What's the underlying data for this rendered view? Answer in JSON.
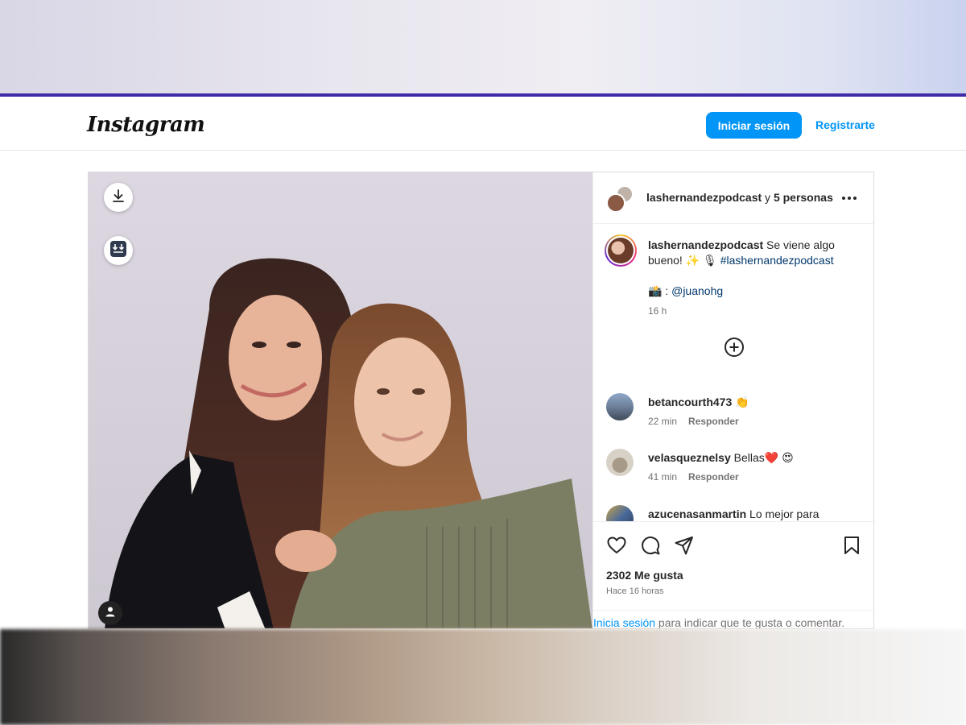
{
  "header": {
    "logo": "Instagram",
    "login_label": "Iniciar sesión",
    "register_label": "Registrarte"
  },
  "post": {
    "owner": "lashernandezpodcast",
    "collab_joiner": " y ",
    "collab_others": "5 personas",
    "caption_user": "lashernandezpodcast",
    "caption_text": " Se viene algo bueno! ✨ 🎙 ",
    "caption_hashtag": "#lashernandezpodcast",
    "credit_prefix": "📸 : ",
    "credit_user": "@juanohg",
    "caption_time": "16 h",
    "comments": [
      {
        "user": "betancourth473",
        "text": " 👏",
        "time": "22 min",
        "reply": "Responder"
      },
      {
        "user": "velasqueznelsy",
        "text": " Bellas❤️ 😍",
        "time": "41 min",
        "reply": "Responder"
      },
      {
        "user": "azucenasanmartin",
        "text": " Lo mejor para ustedes.",
        "time": "",
        "reply": ""
      }
    ],
    "likes": "2302 Me gusta",
    "posted_ago": "Hace 16 horas",
    "login_link": "Inicia sesión",
    "login_suffix": " para indicar que te gusta o comentar."
  },
  "colors": {
    "accent": "#0095f6",
    "link": "#00376b",
    "top_rule": "#3f2aa8"
  },
  "icons": [
    "download-icon",
    "save-to-device-icon",
    "user-tag-icon",
    "more-options-icon",
    "add-comment-icon",
    "heart-icon",
    "comment-icon",
    "share-icon",
    "bookmark-icon"
  ]
}
